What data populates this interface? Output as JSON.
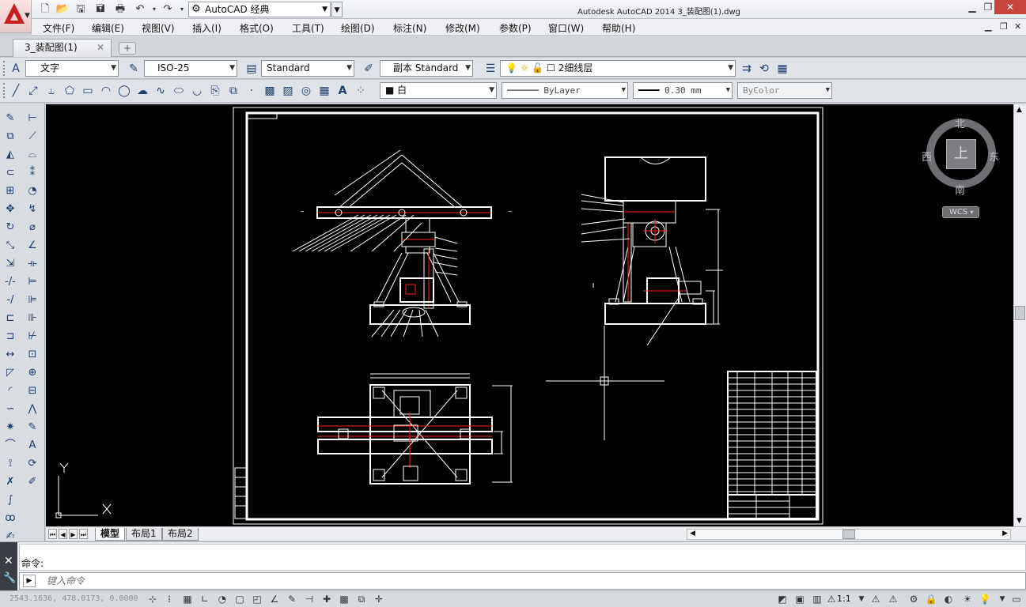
{
  "window": {
    "title": "Autodesk AutoCAD 2014    3_装配图(1).dwg",
    "workspace": "AutoCAD 经典"
  },
  "menu": [
    "文件(F)",
    "编辑(E)",
    "视图(V)",
    "插入(I)",
    "格式(O)",
    "工具(T)",
    "绘图(D)",
    "标注(N)",
    "修改(M)",
    "参数(P)",
    "窗口(W)",
    "帮助(H)"
  ],
  "doc_tab": {
    "label": "3_装配图(1)"
  },
  "styles": {
    "text_style": "文字",
    "dim_style": "ISO-25",
    "table_style": "Standard",
    "multileader_style": "副本 Standard",
    "layer": "2细线层"
  },
  "properties": {
    "color": "白",
    "linetype": "ByLayer",
    "lineweight": "0.30 mm",
    "plotstyle": "ByColor"
  },
  "viewcube": {
    "north": "北",
    "south": "南",
    "west": "西",
    "east": "东",
    "face": "上",
    "wcs": "WCS"
  },
  "ucs": {
    "x": "X",
    "y": "Y"
  },
  "layout_tabs": [
    "模型",
    "布局1",
    "布局2"
  ],
  "command": {
    "history": "命令:",
    "placeholder": "键入命令"
  },
  "status": {
    "coords": "2543.1636, 478.0173, 0.0000",
    "scale": "1:1"
  },
  "colors": {
    "canvas": "#000000",
    "linework": "#ffffff",
    "centerline": "#ff2020",
    "accent": "#c81d1d"
  }
}
